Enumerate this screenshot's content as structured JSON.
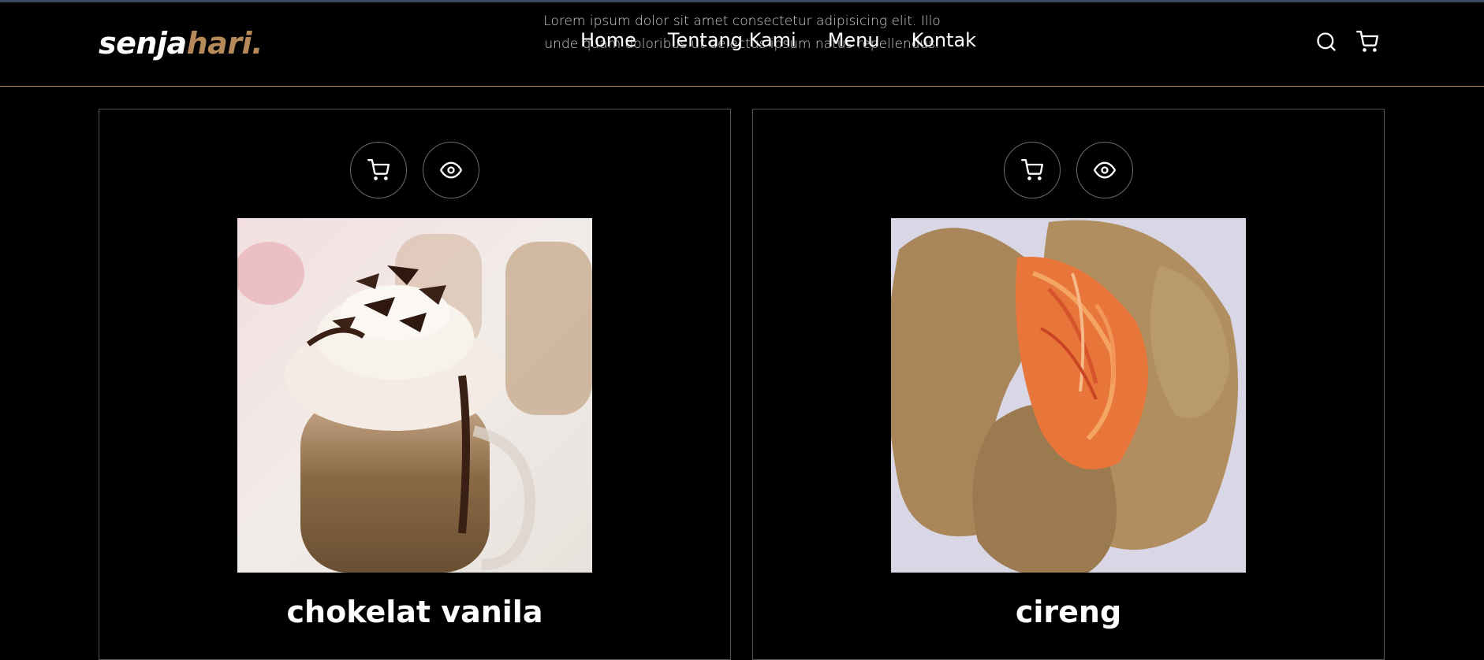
{
  "header": {
    "logo": {
      "main": "senja",
      "accent": "hari",
      "dot": "."
    },
    "lorem_text": "Lorem ipsum dolor sit amet consectetur adipisicing elit. Illo unde quam doloribus ut delectus ipsum natus repellendus.",
    "nav": [
      {
        "label": "Home"
      },
      {
        "label": "Tentang Kami"
      },
      {
        "label": "Menu"
      },
      {
        "label": "Kontak"
      }
    ],
    "icons": [
      "search-icon",
      "shopping-cart-icon"
    ]
  },
  "products": [
    {
      "name": "chokelat vanila",
      "image": "hot chocolate with whipped cream and chocolate shavings"
    },
    {
      "name": "cireng",
      "image": "fried cireng filled with spicy shredded filling"
    }
  ],
  "colors": {
    "background": "#000000",
    "accent": "#b6895b",
    "text": "#ffffff",
    "card_border": "#555555"
  }
}
